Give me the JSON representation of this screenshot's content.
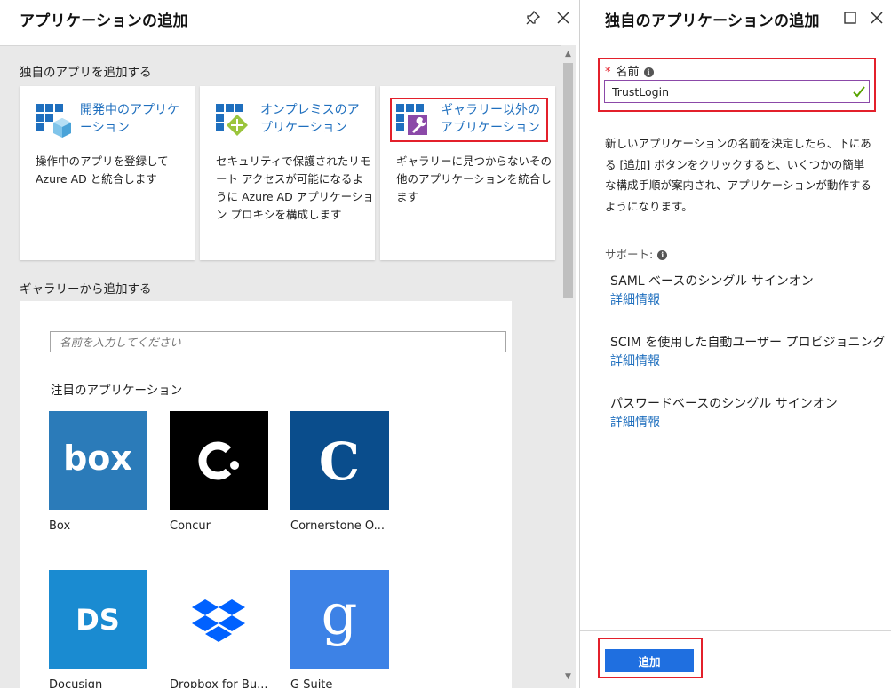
{
  "left_blade": {
    "title": "アプリケーションの追加",
    "custom_section_label": "独自のアプリを追加する",
    "cards": [
      {
        "title": "開発中のアプリケーション",
        "description": "操作中のアプリを登録してAzure AD と統合します"
      },
      {
        "title": "オンプレミスのアプリケーション",
        "description": "セキュリティで保護されたリモート アクセスが可能になるように Azure AD アプリケーション プロキシを構成します"
      },
      {
        "title": "ギャラリー以外のアプリケーション",
        "description": "ギャラリーに見つからないその他のアプリケーションを統合します"
      }
    ],
    "gallery_section_label": "ギャラリーから追加する",
    "search": {
      "placeholder": "名前を入力してください",
      "value": ""
    },
    "featured_label": "注目のアプリケーション",
    "apps": [
      {
        "name": "Box",
        "logo_text": "box",
        "color": "#2b7bb9"
      },
      {
        "name": "Concur",
        "logo_text": "C",
        "color": "#000000"
      },
      {
        "name": "Cornerstone O...",
        "logo_text": "C",
        "color": "#0a4d8c"
      },
      {
        "name": "Docusign",
        "logo_text": "DS",
        "color": "#1a8bd1"
      },
      {
        "name": "Dropbox for Bu...",
        "logo_text": "",
        "color": "#ffffff"
      },
      {
        "name": "G Suite",
        "logo_text": "g",
        "color": "#3d82e6"
      }
    ]
  },
  "right_blade": {
    "title": "独自のアプリケーションの追加",
    "name_label": "名前",
    "name_value": "TrustLogin",
    "description": "新しいアプリケーションの名前を決定したら、下にある [追加] ボタンをクリックすると、いくつかの簡単な構成手順が案内され、アプリケーションが動作するようになります。",
    "support_label": "サポート:",
    "support_items": [
      {
        "text": "SAML ベースのシングル サインオン",
        "link": "詳細情報"
      },
      {
        "text": "SCIM を使用した自動ユーザー プロビジョニング",
        "link": "詳細情報"
      },
      {
        "text": "パスワードベースのシングル サインオン",
        "link": "詳細情報"
      }
    ],
    "add_button_label": "追加"
  },
  "colors": {
    "accent_blue": "#1f6fe0",
    "link_blue": "#1f6fbe",
    "highlight_red": "#e3202b",
    "input_border_purple": "#8b49a8",
    "success_green": "#57a300"
  }
}
